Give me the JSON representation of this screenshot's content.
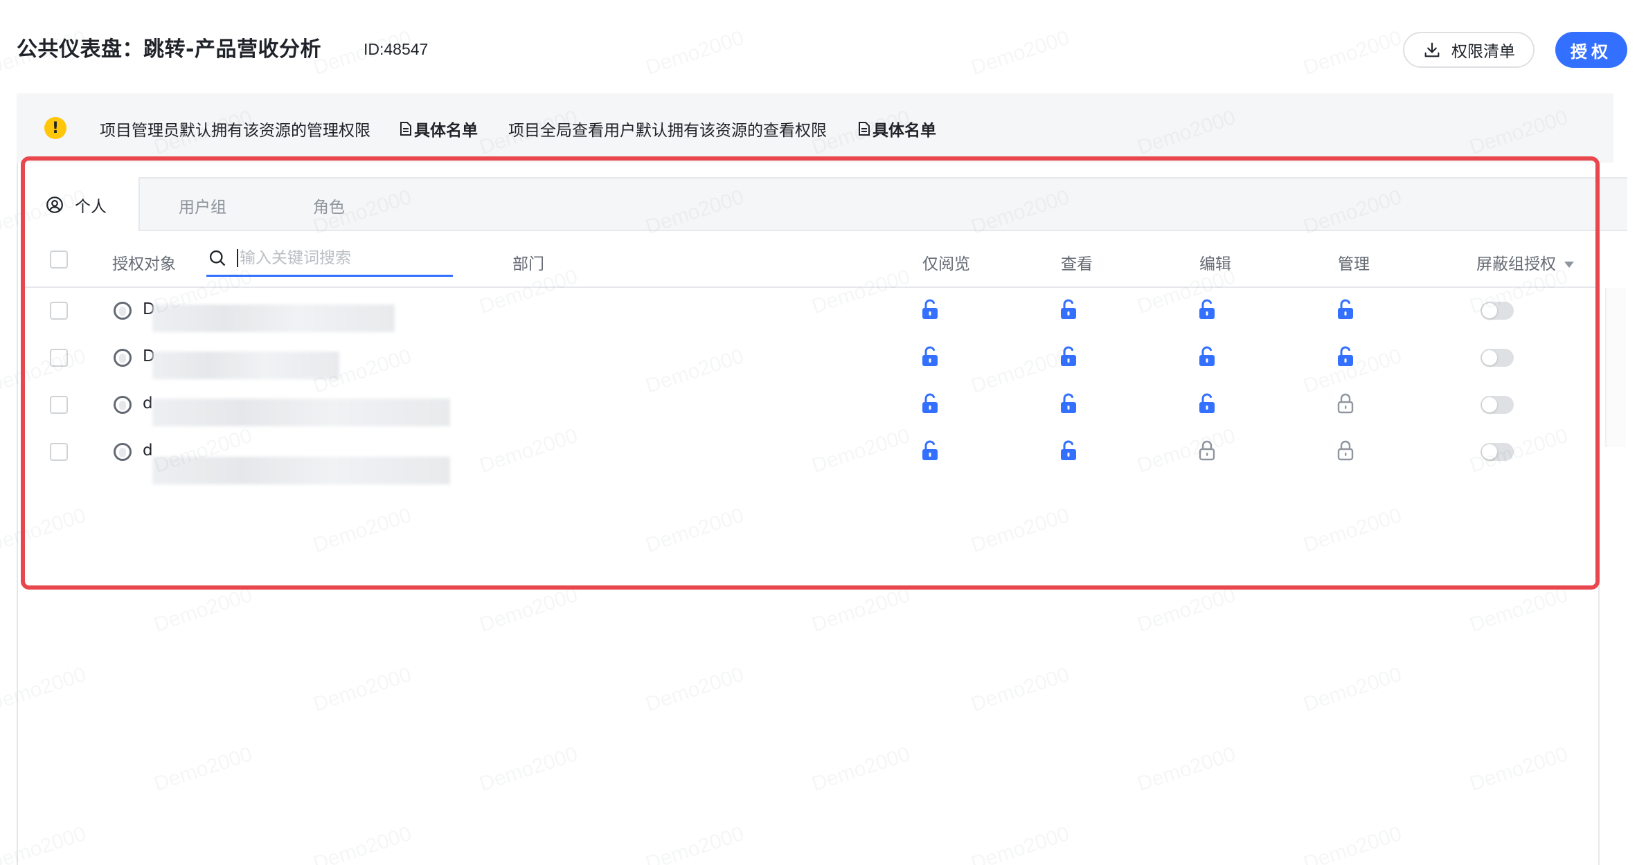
{
  "header": {
    "title": "公共仪表盘：跳转-产品营收分析",
    "id_label": "ID:48547",
    "permission_list_label": "权限清单",
    "authorize_label": "授权"
  },
  "notice": {
    "text1": "项目管理员默认拥有该资源的管理权限",
    "link1": "具体名单",
    "text2": "项目全局查看用户默认拥有该资源的查看权限",
    "link2": "具体名单",
    "warn_symbol": "!"
  },
  "tabs": [
    {
      "label": "个人",
      "active": true
    },
    {
      "label": "用户组",
      "active": false
    },
    {
      "label": "角色",
      "active": false
    }
  ],
  "table": {
    "headers": {
      "target": "授权对象",
      "department": "部门",
      "browse": "仅阅览",
      "view": "查看",
      "edit": "编辑",
      "manage": "管理",
      "block": "屏蔽组授权"
    },
    "search_placeholder": "输入关键词搜索",
    "rows": [
      {
        "name": "D",
        "perms": [
          "unlocked",
          "unlocked",
          "unlocked",
          "unlocked"
        ],
        "block": false
      },
      {
        "name": "D",
        "perms": [
          "unlocked",
          "unlocked",
          "unlocked",
          "unlocked"
        ],
        "block": false
      },
      {
        "name": "d",
        "perms": [
          "unlocked",
          "unlocked",
          "unlocked",
          "locked"
        ],
        "block": false
      },
      {
        "name": "d",
        "perms": [
          "unlocked",
          "unlocked",
          "locked",
          "locked"
        ],
        "block": false
      }
    ]
  },
  "watermark": "Demo2000",
  "colors": {
    "primary": "#3370ff",
    "highlight": "#e8484d",
    "warning": "#ffc60a",
    "locked": "#8f959e"
  }
}
